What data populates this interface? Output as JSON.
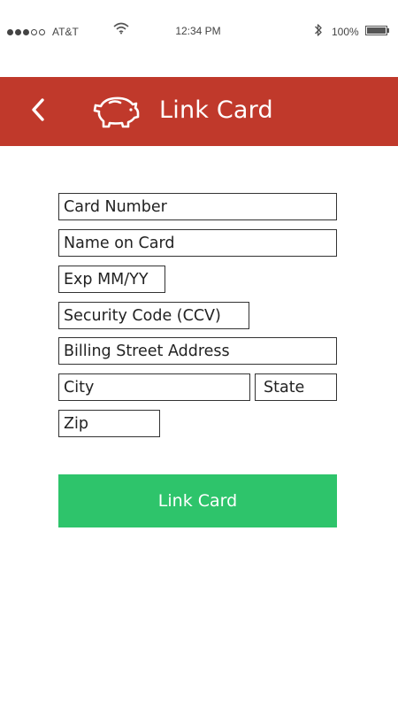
{
  "status_bar": {
    "carrier": "AT&T",
    "signal_bars_filled": 3,
    "signal_bars_total": 5,
    "time": "12:34 PM",
    "battery": "100%",
    "icons": [
      "wifi-icon",
      "bluetooth-icon",
      "battery-icon"
    ]
  },
  "header": {
    "title": "Link Card",
    "back_icon": "chevron-left-icon",
    "logo_icon": "piggy-bank-icon",
    "background": "#c0392b"
  },
  "form": {
    "card_number": {
      "placeholder": "Card Number",
      "value": ""
    },
    "name_on_card": {
      "placeholder": "Name on Card",
      "value": ""
    },
    "exp": {
      "placeholder": "Exp MM/YY",
      "value": ""
    },
    "security_code": {
      "placeholder": "Security Code (CCV)",
      "value": ""
    },
    "billing_address": {
      "placeholder": "Billing Street Address",
      "value": ""
    },
    "city": {
      "placeholder": "City",
      "value": ""
    },
    "state": {
      "placeholder": "State",
      "value": ""
    },
    "zip": {
      "placeholder": "Zip",
      "value": ""
    }
  },
  "submit": {
    "label": "Link Card",
    "color": "#2ec46b"
  }
}
